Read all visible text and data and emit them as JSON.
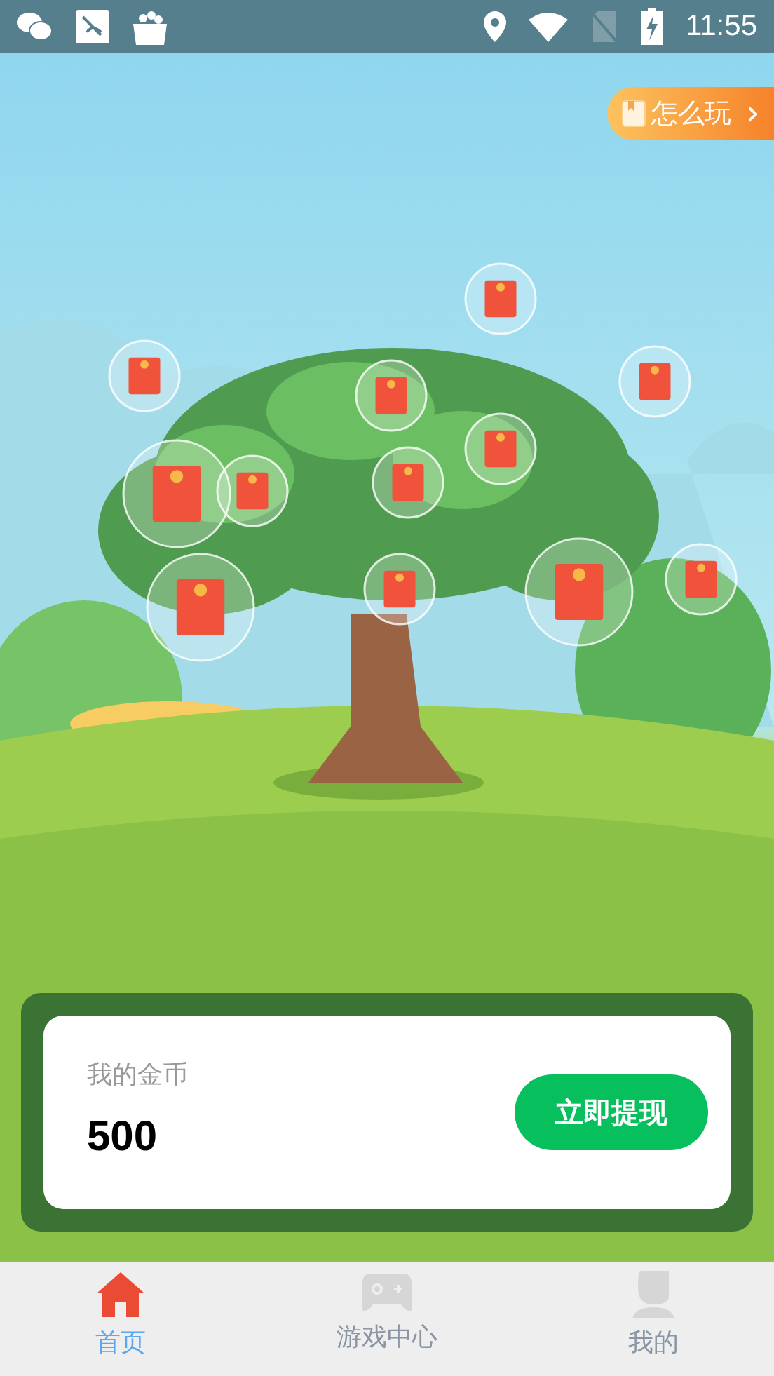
{
  "status_bar": {
    "time": "11:55"
  },
  "how_to_play": {
    "label": "怎么玩",
    "arrow": "›"
  },
  "coins": {
    "label": "我的金币",
    "value": "500"
  },
  "withdraw_button": {
    "label": "立即提现"
  },
  "tabs": [
    {
      "label": "首页",
      "kind": "home",
      "selected": true
    },
    {
      "label": "游戏中心",
      "kind": "game",
      "selected": false
    },
    {
      "label": "我的",
      "kind": "profile",
      "selected": false
    }
  ]
}
